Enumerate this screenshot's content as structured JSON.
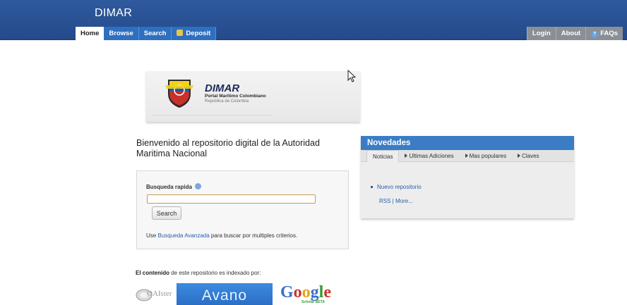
{
  "header": {
    "title": "DIMAR",
    "tabs_left": [
      {
        "label": "Home",
        "active": true
      },
      {
        "label": "Browse"
      },
      {
        "label": "Search"
      },
      {
        "label": "Deposit",
        "icon": "lock-icon"
      }
    ],
    "tabs_right": [
      {
        "label": "Login"
      },
      {
        "label": "About"
      },
      {
        "label": "FAQs",
        "icon": "help-icon"
      }
    ]
  },
  "logo": {
    "name": "DIMAR",
    "subtitle": "Portal Marítimo Colombiano",
    "country": "República de Colombia"
  },
  "welcome": "Bienvenido al repositorio digital de la Autoridad Maritima Nacional",
  "quick_search": {
    "label": "Busqueda rapida",
    "input_value": "",
    "button_label": "Search",
    "note_prefix": "Use ",
    "note_link": "Busqueda Avanzada",
    "note_suffix": " para buscar por multiples criterios."
  },
  "indexed": {
    "bold": "El contenido",
    "rest": " de este repositorio es indexado por:",
    "partners": [
      "OAIster",
      "Avano",
      "Google Scholar"
    ],
    "oaister_text": "OAIster",
    "avano_text": "Avano",
    "scholar_text": "Scholar BETA"
  },
  "news": {
    "title": "Novedades",
    "tabs": [
      "Noticias",
      "Ultimas Adiciones",
      "Mas populares",
      "Claves"
    ],
    "items": [
      "Nuevo repositorio"
    ],
    "rss": "RSS",
    "more": "More..."
  },
  "colors": {
    "header_blue": "#2f5a9e",
    "tab_blue": "#2f6fbf",
    "tab_grey": "#8a8f96",
    "panel_blue": "#3b7cc5",
    "link": "#2a5fa8"
  }
}
